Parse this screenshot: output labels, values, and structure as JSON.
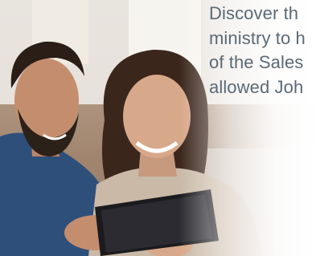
{
  "hero": {
    "headline_lines": [
      "Discover th",
      "ministry to h",
      "of the Sales",
      "allowed Joh"
    ],
    "image_alt": "Smiling couple looking at a tablet",
    "colors": {
      "headline_text": "#5b6975",
      "background": "#ffffff"
    }
  }
}
